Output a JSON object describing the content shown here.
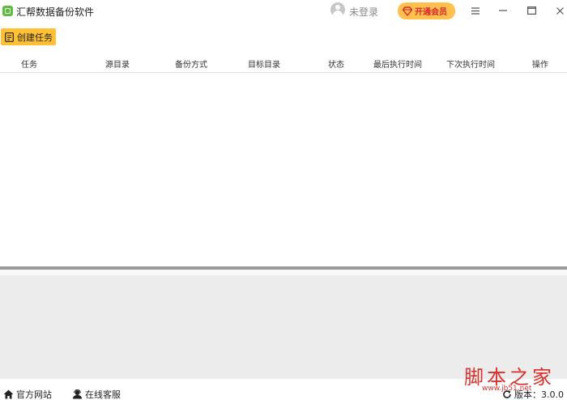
{
  "app": {
    "title": "汇帮数据备份软件",
    "logo_icon": "app-logo-icon",
    "accent": "#5ebd3e"
  },
  "header": {
    "user_label": "未登录",
    "vip_label": "开通会员",
    "vip_color": "#ffc04d",
    "menu_icon": "hamburger-menu-icon",
    "minimize_icon": "minimize-icon",
    "maximize_icon": "maximize-icon",
    "close_icon": "close-icon"
  },
  "toolbar": {
    "create_label": "创建任务",
    "create_color": "#ffc133"
  },
  "table": {
    "columns": [
      "任务",
      "源目录",
      "备份方式",
      "目标目录",
      "状态",
      "最后执行时间",
      "下次执行时间",
      "操作"
    ],
    "rows": []
  },
  "statusbar": {
    "website_label": "官方网站",
    "support_label": "在线客服",
    "version_label": "版本：3.0.0"
  },
  "watermark": {
    "text": "脚本之家",
    "url": "www.jb51.net"
  }
}
